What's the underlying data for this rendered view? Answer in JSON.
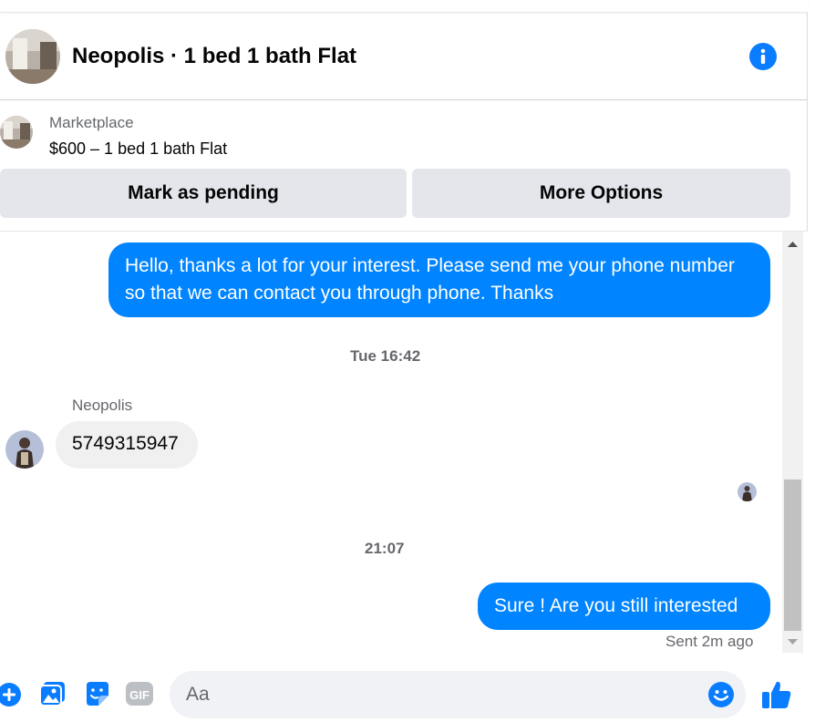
{
  "header": {
    "title": "Neopolis · 1 bed 1 bath Flat",
    "info_icon": "info-icon"
  },
  "listing": {
    "source": "Marketplace",
    "price_line": "$600 – 1 bed 1 bath Flat"
  },
  "actions": {
    "mark_pending": "Mark as pending",
    "more_options": "More Options"
  },
  "messages": {
    "outgoing_1": "Hello, thanks a lot for your interest. Please send me your phone number so that we can contact you through phone. Thanks",
    "timestamp_1": "Tue 16:42",
    "incoming_sender": "Neopolis",
    "incoming_1": "5749315947",
    "timestamp_2": "21:07",
    "outgoing_2": "Sure ! Are you still interested",
    "status": "Sent 2m ago"
  },
  "composer": {
    "placeholder": "Aa",
    "icons": [
      "plus-icon",
      "photo-icon",
      "sticker-icon",
      "gif-icon",
      "emoji-icon",
      "thumbs-up-icon"
    ]
  },
  "colors": {
    "accent": "#0084ff",
    "icon_blue": "#0a7cff",
    "bubble_in": "#f0f0f0",
    "button_bg": "#e4e6eb"
  }
}
